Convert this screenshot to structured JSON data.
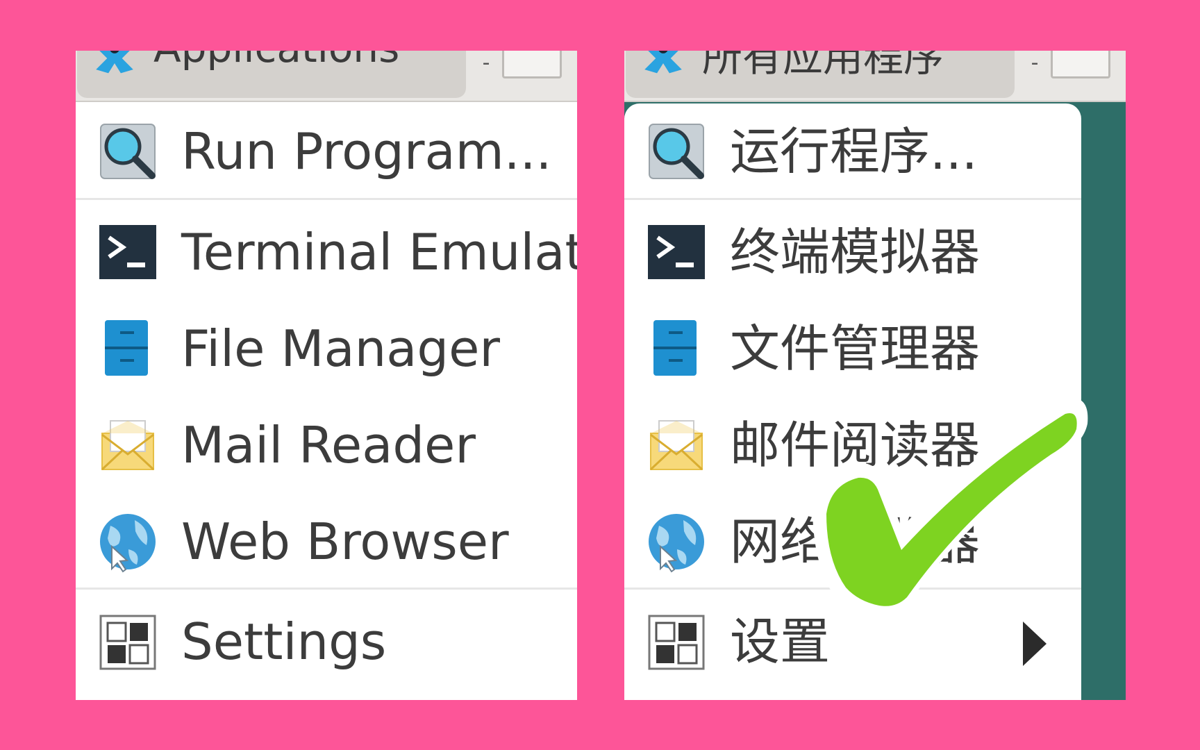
{
  "colors": {
    "background": "#fd5598",
    "checkmark": "#7ed321",
    "desktop": "#2e6e68"
  },
  "left_panel": {
    "header_title": "Applications",
    "items": [
      {
        "icon": "search-icon",
        "label": "Run Program..."
      },
      {
        "icon": "terminal-icon",
        "label": "Terminal Emulator"
      },
      {
        "icon": "file-manager-icon",
        "label": "File Manager"
      },
      {
        "icon": "mail-icon",
        "label": "Mail Reader"
      },
      {
        "icon": "globe-icon",
        "label": "Web Browser"
      },
      {
        "icon": "settings-icon",
        "label": "Settings"
      }
    ]
  },
  "right_panel": {
    "header_title": "所有应用程序",
    "items": [
      {
        "icon": "search-icon",
        "label": "运行程序..."
      },
      {
        "icon": "terminal-icon",
        "label": "终端模拟器"
      },
      {
        "icon": "file-manager-icon",
        "label": "文件管理器"
      },
      {
        "icon": "mail-icon",
        "label": "邮件阅读器"
      },
      {
        "icon": "globe-icon",
        "label": "网络浏览器"
      },
      {
        "icon": "settings-icon",
        "label": "设置"
      }
    ]
  },
  "overlay": {
    "icon": "checkmark-icon"
  }
}
